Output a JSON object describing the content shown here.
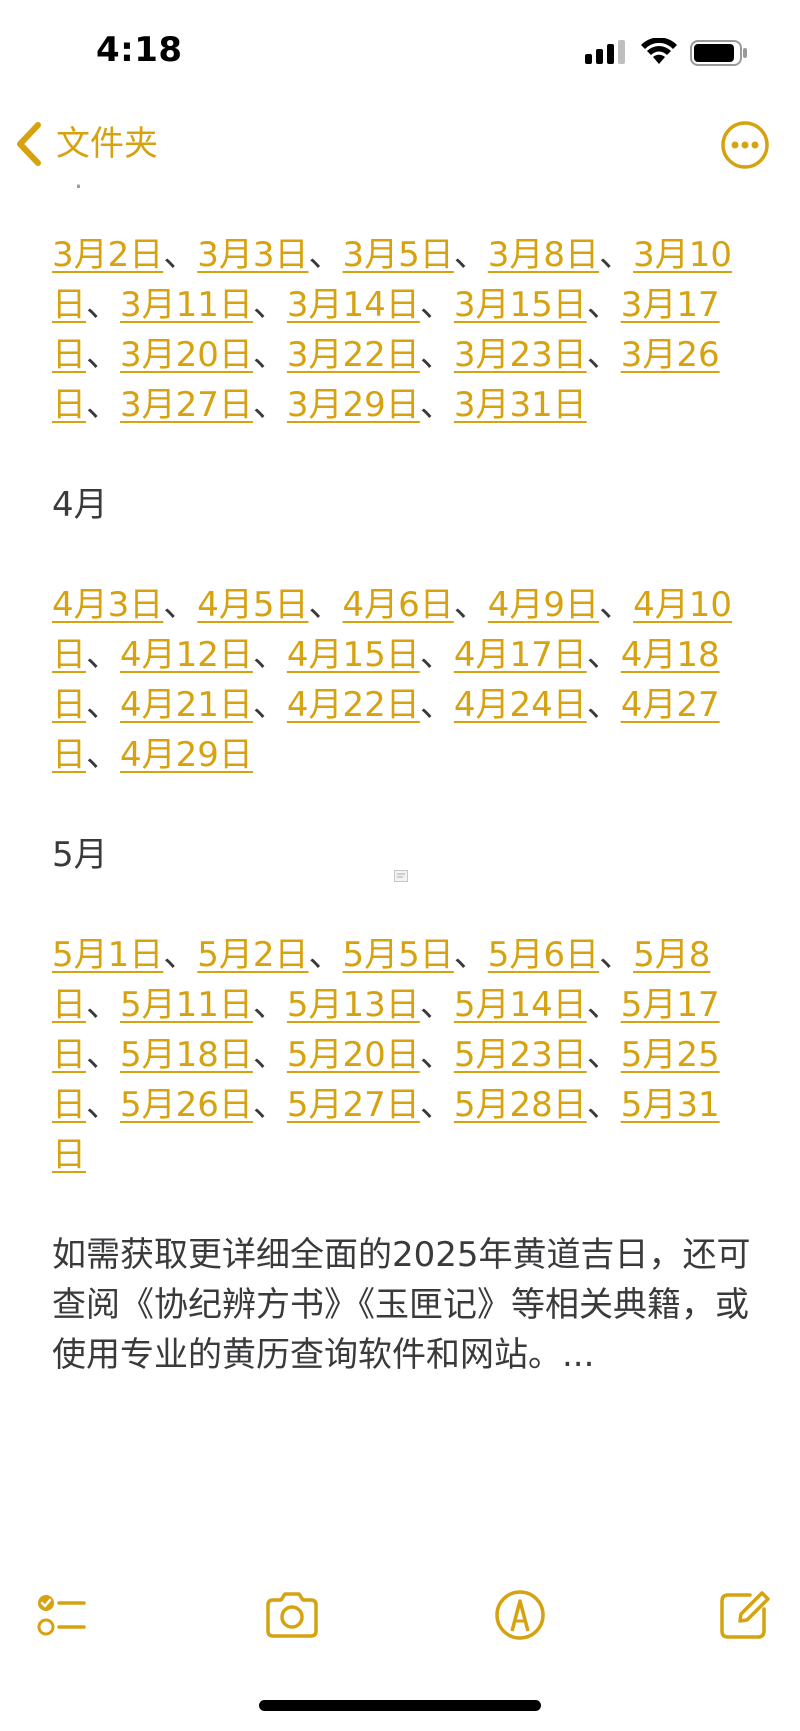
{
  "status_bar": {
    "time": "4:18",
    "icons": [
      "cellular-signal-icon",
      "wifi-icon",
      "battery-icon"
    ]
  },
  "nav": {
    "back_label": "文件夹",
    "back_icon": "chevron-left-icon",
    "more_icon": "ellipsis-circle-icon"
  },
  "colors": {
    "accent": "#d7a20f",
    "text": "#3a3a3c",
    "background": "#ffffff"
  },
  "content": {
    "march_dates": [
      "3月2日",
      "3月3日",
      "3月5日",
      "3月8日",
      "3月10日",
      "3月11日",
      "3月14日",
      "3月15日",
      "3月17日",
      "3月20日",
      "3月22日",
      "3月23日",
      "3月26日",
      "3月27日",
      "3月29日",
      "3月31日"
    ],
    "april_heading": "4月",
    "april_dates": [
      "4月3日",
      "4月5日",
      "4月6日",
      "4月9日",
      "4月10日",
      "4月12日",
      "4月15日",
      "4月17日",
      "4月18日",
      "4月21日",
      "4月22日",
      "4月24日",
      "4月27日",
      "4月29日"
    ],
    "may_heading": "5月",
    "may_dates": [
      "5月1日",
      "5月2日",
      "5月5日",
      "5月6日",
      "5月8日",
      "5月11日",
      "5月13日",
      "5月14日",
      "5月17日",
      "5月18日",
      "5月20日",
      "5月23日",
      "5月25日",
      "5月26日",
      "5月27日",
      "5月28日",
      "5月31日"
    ],
    "separator": "、",
    "footer_text": "如需获取更详细全面的2025年黄道吉日，还可查阅《协纪辨方书》《玉匣记》等相关典籍，或使用专业的黄历查询软件和网站。..."
  },
  "toolbar": {
    "checklist_icon": "checklist-icon",
    "camera_icon": "camera-icon",
    "markup_icon": "markup-pen-icon",
    "compose_icon": "compose-icon"
  }
}
